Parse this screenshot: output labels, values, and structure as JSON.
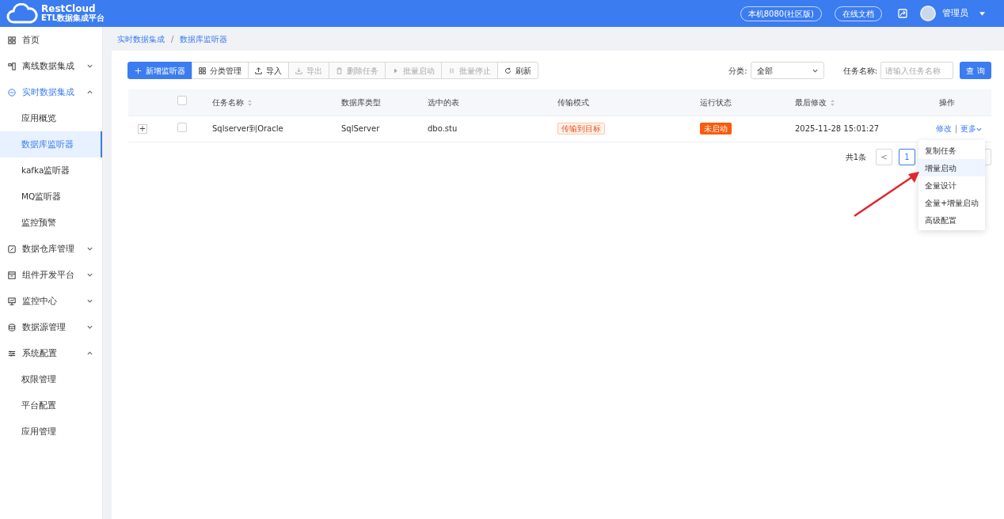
{
  "header": {
    "logo_title": "RestCloud",
    "logo_subtitle": "ETL数据集成平台",
    "links": [
      "本机8080(社区版)",
      "在线文档"
    ],
    "user": "管理员"
  },
  "sidebar": {
    "items": [
      {
        "label": "首页",
        "kind": "grid",
        "selected": false
      },
      {
        "label": "离线数据集成",
        "kind": "flow",
        "selected": false,
        "expanded": false
      },
      {
        "label": "实时数据集成",
        "kind": "gauge",
        "selected": true,
        "expanded": true,
        "children": [
          {
            "label": "应用概览",
            "selected": false
          },
          {
            "label": "数据库监听器",
            "selected": true
          },
          {
            "label": "kafka监听器",
            "selected": false
          },
          {
            "label": "MQ监听器",
            "selected": false
          },
          {
            "label": "监控预警",
            "selected": false
          }
        ]
      },
      {
        "label": "数据仓库管理",
        "kind": "edit",
        "selected": false,
        "expanded": false
      },
      {
        "label": "组件开发平台",
        "kind": "window",
        "selected": false,
        "expanded": false
      },
      {
        "label": "监控中心",
        "kind": "monitor",
        "selected": false,
        "expanded": false
      },
      {
        "label": "数据源管理",
        "kind": "database",
        "selected": false,
        "expanded": false
      },
      {
        "label": "系统配置",
        "kind": "sliders",
        "selected": false,
        "expanded": true,
        "children": [
          {
            "label": "权限管理",
            "selected": false
          },
          {
            "label": "平台配置",
            "selected": false
          },
          {
            "label": "应用管理",
            "selected": false
          }
        ]
      }
    ]
  },
  "breadcrumb": {
    "items": [
      "实时数据集成",
      "数据库监听器"
    ],
    "separator": "/"
  },
  "toolbar": [
    {
      "label": "新增监听器",
      "kind": "plus",
      "primary": true,
      "disabled": false
    },
    {
      "label": "分类管理",
      "kind": "grid",
      "primary": false,
      "disabled": false
    },
    {
      "label": "导入",
      "kind": "upload",
      "primary": false,
      "disabled": false
    },
    {
      "label": "导出",
      "kind": "download",
      "primary": false,
      "disabled": true
    },
    {
      "label": "删除任务",
      "kind": "trash",
      "primary": false,
      "disabled": true
    },
    {
      "label": "批量启动",
      "kind": "play",
      "primary": false,
      "disabled": true
    },
    {
      "label": "批量停止",
      "kind": "pause",
      "primary": false,
      "disabled": true
    },
    {
      "label": "刷新",
      "kind": "refresh",
      "primary": false,
      "disabled": false
    }
  ],
  "filters": {
    "category_label": "分类:",
    "category_value": "全部",
    "name_label": "任务名称:",
    "name_placeholder": "请输入任务名称",
    "search_button": "查 询"
  },
  "table": {
    "select_all_checked": false,
    "columns": [
      {
        "label": "任务名称",
        "sortable": true
      },
      {
        "label": "数据库类型",
        "sortable": false
      },
      {
        "label": "选中的表",
        "sortable": false
      },
      {
        "label": "传输模式",
        "sortable": false
      },
      {
        "label": "运行状态",
        "sortable": false
      },
      {
        "label": "最后修改",
        "sortable": true
      },
      {
        "label": "操作",
        "sortable": false
      }
    ],
    "rows": [
      {
        "expand": "+",
        "checked": false,
        "name": "Sqlserver到Oracle",
        "db_type": "SqlServer",
        "tables": "dbo.stu",
        "mode": "传输到目标",
        "status": "未启动",
        "modified": "2025-11-28 15:01:27",
        "actions": [
          "修改",
          "更多"
        ],
        "action_separator": "|"
      }
    ]
  },
  "pagination": {
    "total": "共1条",
    "prev": "<",
    "pages": [
      {
        "label": "1",
        "selected": true
      }
    ]
  },
  "more_menu": [
    {
      "label": "复制任务",
      "selected": false
    },
    {
      "label": "增量启动",
      "selected": true
    },
    {
      "label": "全量设计",
      "selected": false
    },
    {
      "label": "全量+增量启动",
      "selected": false
    },
    {
      "label": "高级配置",
      "selected": false
    }
  ]
}
